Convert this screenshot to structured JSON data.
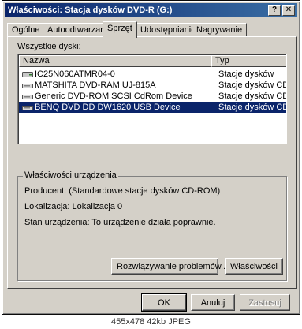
{
  "window": {
    "title": "Właściwości: Stacja dysków DVD-R (G:)",
    "help_button": "?",
    "close_button": "✕"
  },
  "tabs": [
    {
      "label": "Ogólne"
    },
    {
      "label": "Autoodtwarzanie"
    },
    {
      "label": "Sprzęt"
    },
    {
      "label": "Udostępnianie"
    },
    {
      "label": "Nagrywanie"
    }
  ],
  "active_tab": "Sprzęt",
  "devices": {
    "label": "Wszystkie dyski:",
    "columns": {
      "name": "Nazwa",
      "type": "Typ"
    },
    "rows": [
      {
        "name": "IC25N060ATMR04-0",
        "type": "Stacje dysków",
        "icon": "hard-disk-icon",
        "selected": false
      },
      {
        "name": "MATSHITA DVD-RAM UJ-815A",
        "type": "Stacje dysków CD-RO",
        "icon": "cd-drive-icon",
        "selected": false
      },
      {
        "name": "Generic DVD-ROM SCSI CdRom Device",
        "type": "Stacje dysków CD-RO",
        "icon": "cd-drive-icon",
        "selected": false
      },
      {
        "name": "BENQ DVD DD DW1620 USB Device",
        "type": "Stacje dysków CD-RO",
        "icon": "cd-drive-icon",
        "selected": true
      }
    ]
  },
  "properties": {
    "legend": "Właściwości urządzenia",
    "manufacturer": "Producent: (Standardowe stacje dysków CD-ROM)",
    "location": "Lokalizacja: Lokalizacja 0",
    "status": "Stan urządzenia: To urządzenie działa poprawnie.",
    "troubleshoot_button": "Rozwiązywanie problemów...",
    "properties_button": "Właściwości"
  },
  "footer": {
    "ok": "OK",
    "cancel": "Anuluj",
    "apply": "Zastosuj"
  },
  "image_caption": "455x478 42kb JPEG",
  "colors": {
    "titlebar_start": "#0a246a",
    "titlebar_end": "#3a6ea5",
    "face": "#d4d0c8",
    "selection": "#0a246a"
  }
}
